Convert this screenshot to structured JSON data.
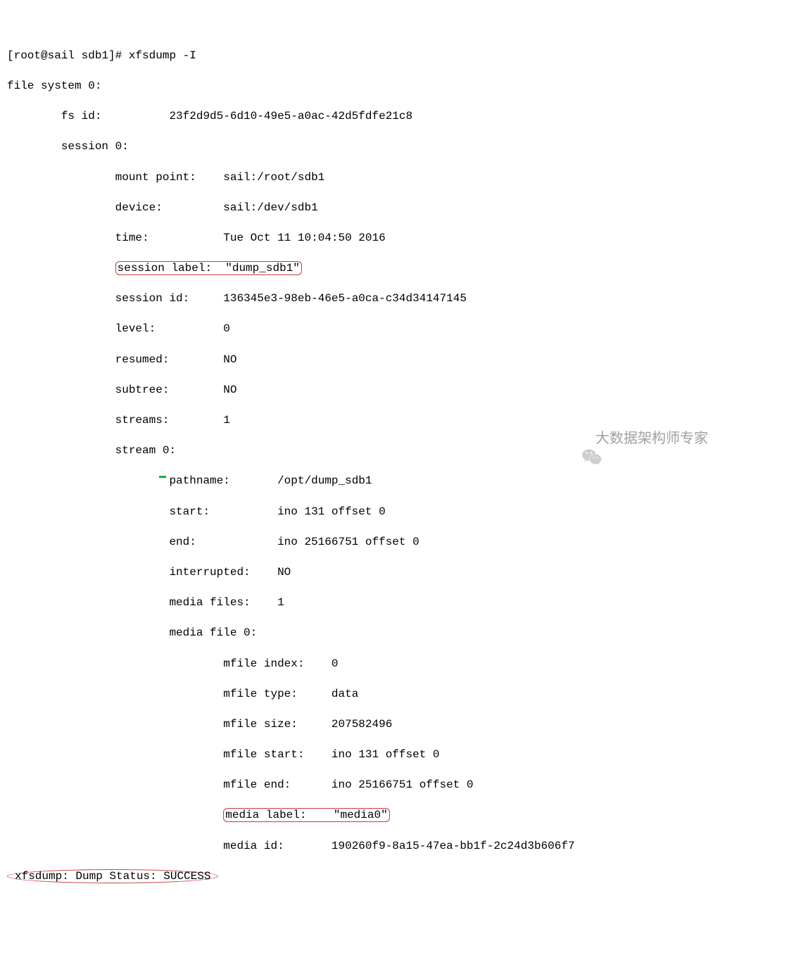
{
  "prompt": "[root@sail sdb1]# ",
  "command": "xfsdump -I",
  "fs_header": "file system 0:",
  "fs_id_label": "fs id:",
  "fs_id_value": "23f2d9d5-6d10-49e5-a0ac-42d5fdfe21c8",
  "session_header": "session 0:",
  "session": {
    "mount_point_label": "mount point:",
    "mount_point_value": "sail:/root/sdb1",
    "device_label": "device:",
    "device_value": "sail:/dev/sdb1",
    "time_label": "time:",
    "time_value": "Tue Oct 11 10:04:50 2016",
    "session_label_label": "session label:",
    "session_label_value": "\"dump_sdb1\"",
    "session_id_label": "session id:",
    "session_id_value": "136345e3-98eb-46e5-a0ca-c34d34147145",
    "level_label": "level:",
    "level_value": "0",
    "resumed_label": "resumed:",
    "resumed_value": "NO",
    "subtree_label": "subtree:",
    "subtree_value": "NO",
    "streams_label": "streams:",
    "streams_value": "1"
  },
  "stream_header": "stream 0:",
  "stream": {
    "pathname_label": "pathname:",
    "pathname_value": "/opt/dump_sdb1",
    "start_label": "start:",
    "start_value": "ino 131 offset 0",
    "end_label": "end:",
    "end_value": "ino 25166751 offset 0",
    "interrupted_label": "interrupted:",
    "interrupted_value": "NO",
    "media_files_label": "media files:",
    "media_files_value": "1"
  },
  "media_file_header": "media file 0:",
  "media_file": {
    "mfile_index_label": "mfile index:",
    "mfile_index_value": "0",
    "mfile_type_label": "mfile type:",
    "mfile_type_value": "data",
    "mfile_size_label": "mfile size:",
    "mfile_size_value": "207582496",
    "mfile_start_label": "mfile start:",
    "mfile_start_value": "ino 131 offset 0",
    "mfile_end_label": "mfile end:",
    "mfile_end_value": "ino 25166751 offset 0",
    "media_label_label": "media label:",
    "media_label_value": "\"media0\"",
    "media_id_label": "media id:",
    "media_id_value": "190260f9-8a15-47ea-bb1f-2c24d3b606f7"
  },
  "status_line": "xfsdump: Dump Status: SUCCESS",
  "watermark_text": "大数据架构师专家"
}
